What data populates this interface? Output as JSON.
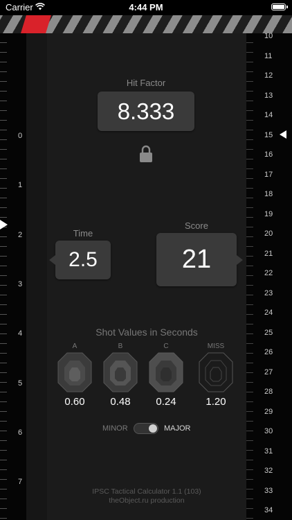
{
  "status_bar": {
    "carrier": "Carrier",
    "time": "4:44 PM"
  },
  "hit_factor": {
    "label": "Hit Factor",
    "value": "8.333"
  },
  "time": {
    "label": "Time",
    "value": "2.5"
  },
  "score": {
    "label": "Score",
    "value": "21"
  },
  "shot_values": {
    "title": "Shot Values in Seconds",
    "targets": [
      {
        "label": "A",
        "value": "0.60"
      },
      {
        "label": "B",
        "value": "0.48"
      },
      {
        "label": "C",
        "value": "0.24"
      },
      {
        "label": "MISS",
        "value": "1.20"
      }
    ]
  },
  "power_factor": {
    "minor_label": "MINOR",
    "major_label": "MAJOR",
    "selected": "MAJOR"
  },
  "footer": {
    "line1": "IPSC Tactical Calculator 1.1 (103)",
    "line2": "theObject.ru production"
  },
  "left_ruler": {
    "numbers": [
      "0",
      "1",
      "2",
      "3",
      "4",
      "5",
      "6",
      "7"
    ]
  },
  "right_ruler": {
    "numbers": [
      "10",
      "11",
      "12",
      "13",
      "14",
      "15",
      "16",
      "17",
      "18",
      "19",
      "20",
      "21",
      "22",
      "23",
      "24",
      "25",
      "26",
      "27",
      "28",
      "29",
      "30",
      "31",
      "32",
      "33",
      "34"
    ]
  },
  "colors": {
    "accent_red": "#d9222a",
    "background": "#161616",
    "box": "#3a3a3a"
  }
}
